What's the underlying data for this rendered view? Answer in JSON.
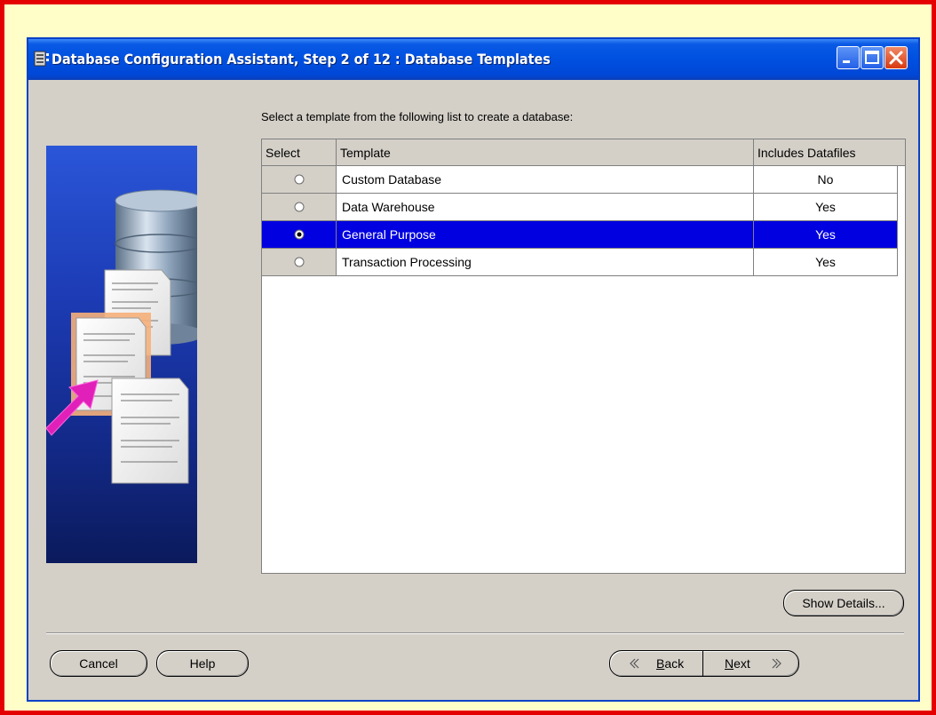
{
  "window": {
    "title": "Database Configuration Assistant, Step 2 of 12 : Database Templates"
  },
  "instruction": "Select a template from the following list to create a database:",
  "table": {
    "columns": [
      "Select",
      "Template",
      "Includes Datafiles"
    ],
    "rows": [
      {
        "template": "Custom Database",
        "includes_datafiles": "No",
        "selected": false
      },
      {
        "template": "Data Warehouse",
        "includes_datafiles": "Yes",
        "selected": false
      },
      {
        "template": "General Purpose",
        "includes_datafiles": "Yes",
        "selected": true
      },
      {
        "template": "Transaction Processing",
        "includes_datafiles": "Yes",
        "selected": false
      }
    ]
  },
  "buttons": {
    "show_details": "Show Details...",
    "cancel": "Cancel",
    "help": "Help",
    "back_mnemonic": "B",
    "back_rest": "ack",
    "next_mnemonic": "N",
    "next_rest": "ext"
  },
  "colors": {
    "title_bar": "#0050e0",
    "selection": "#0000e0",
    "outer_frame": "#e40000",
    "page_background": "#fffdc8"
  },
  "icons": {
    "title": "database-app-icon",
    "minimize": "minimize-icon",
    "maximize": "maximize-icon",
    "close": "close-icon",
    "back": "chevron-left-icon",
    "next": "chevron-right-icon"
  }
}
